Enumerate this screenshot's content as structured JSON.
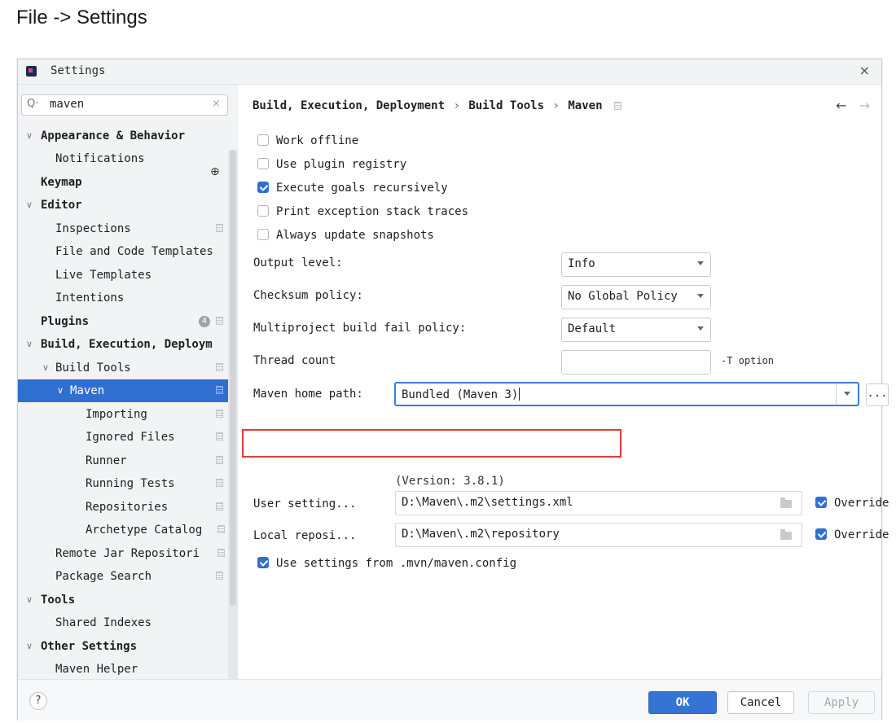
{
  "caption": "File -> Settings",
  "window": {
    "title": "Settings",
    "close": "×"
  },
  "search": {
    "value": "maven",
    "clear": "×",
    "icon": "Q·"
  },
  "sidebar": {
    "items": [
      {
        "label": "Appearance & Behavior",
        "chev": "∨"
      },
      {
        "label": "Notifications"
      },
      {
        "label": "Keymap"
      },
      {
        "label": "Editor",
        "chev": "∨"
      },
      {
        "label": "Inspections"
      },
      {
        "label": "File and Code Templates"
      },
      {
        "label": "Live Templates"
      },
      {
        "label": "Intentions"
      },
      {
        "label": "Plugins",
        "badge": "4"
      },
      {
        "label": "Build, Execution, Deploym",
        "chev": "∨"
      },
      {
        "label": "Build Tools",
        "chev": "∨"
      },
      {
        "label": "Maven",
        "chev": "∨"
      },
      {
        "label": "Importing"
      },
      {
        "label": "Ignored Files"
      },
      {
        "label": "Runner"
      },
      {
        "label": "Running Tests"
      },
      {
        "label": "Repositories"
      },
      {
        "label": "Archetype Catalog"
      },
      {
        "label": "Remote Jar Repositori"
      },
      {
        "label": "Package Search"
      },
      {
        "label": "Tools",
        "chev": "∨"
      },
      {
        "label": "Shared Indexes"
      },
      {
        "label": "Other Settings",
        "chev": "∨"
      },
      {
        "label": "Maven Helper"
      }
    ]
  },
  "breadcrumb": {
    "part1": "Build, Execution, Deployment",
    "part2": "Build Tools",
    "part3": "Maven",
    "sep": "›"
  },
  "nav": {
    "back": "←",
    "forward": "→"
  },
  "checkboxes": [
    {
      "label": "Work offline",
      "checked": false
    },
    {
      "label": "Use plugin registry",
      "checked": false
    },
    {
      "label": "Execute goals recursively",
      "checked": true
    },
    {
      "label": "Print exception stack traces",
      "checked": false
    },
    {
      "label": "Always update snapshots",
      "checked": false
    }
  ],
  "fields": {
    "output_level": {
      "label": "Output level:",
      "value": "Info"
    },
    "checksum_policy": {
      "label": "Checksum policy:",
      "value": "No Global Policy"
    },
    "fail_policy": {
      "label": "Multiproject build fail policy:",
      "value": "Default"
    },
    "thread_count": {
      "label": "Thread count",
      "value": "",
      "hint": "-T option"
    },
    "maven_home": {
      "label": "Maven home path:",
      "value": "Bundled (Maven 3)",
      "browse": "...",
      "version": "(Version: 3.8.1)"
    },
    "user_settings": {
      "label": "User setting...",
      "value": "D:\\Maven\\.m2\\settings.xml",
      "override": "Override",
      "override_checked": true
    },
    "local_repo": {
      "label": "Local reposi...",
      "value": "D:\\Maven\\.m2\\repository",
      "override": "Override",
      "override_checked": true
    }
  },
  "mvn_config": {
    "label": "Use settings from .mvn/maven.config",
    "checked": true
  },
  "footer": {
    "help": "?",
    "ok": "OK",
    "cancel": "Cancel",
    "apply": "Apply"
  },
  "colors": {
    "accent": "#2f6fd0",
    "highlight": "#e53935"
  }
}
